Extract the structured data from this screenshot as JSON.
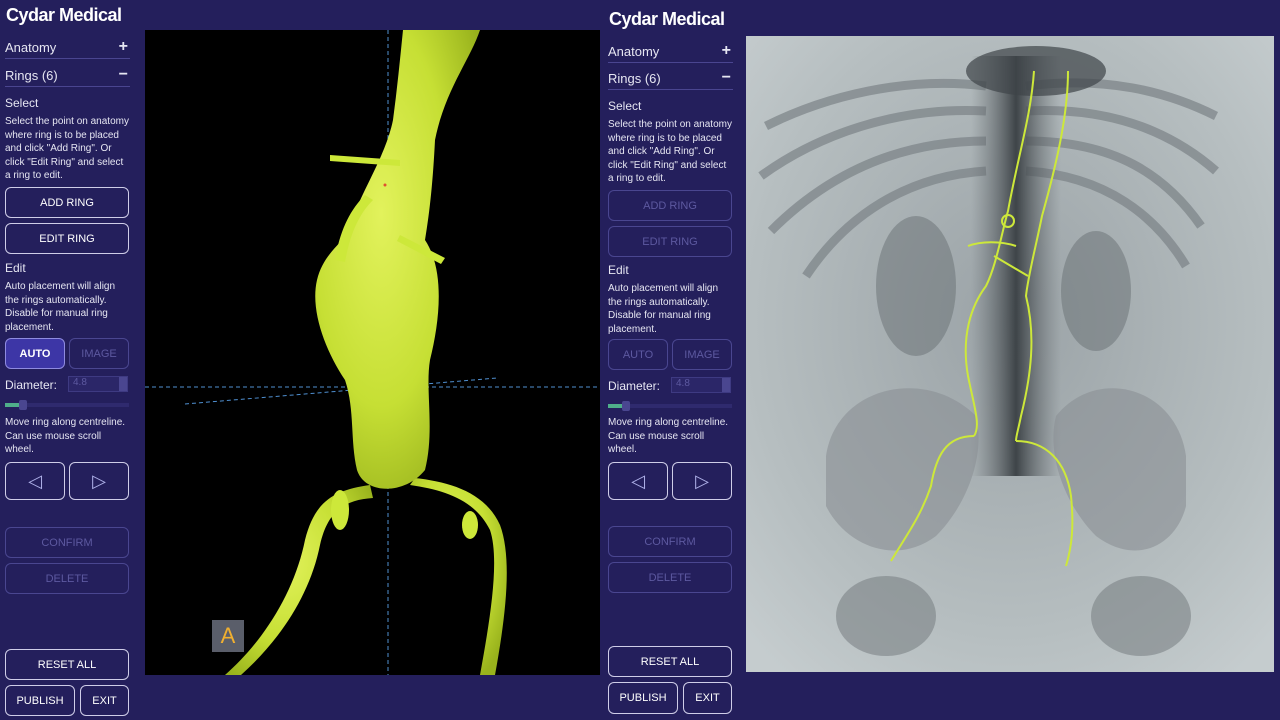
{
  "brand": "Cydar Medical",
  "left_panel": {
    "anatomy_label": "Anatomy",
    "anatomy_toggle": "+",
    "rings_label": "Rings (6)",
    "rings_toggle": "−",
    "select_title": "Select",
    "select_help": "Select the point on anatomy where ring is to be placed and click \"Add Ring\". Or click \"Edit Ring\" and select a ring to edit.",
    "add_ring": "ADD RING",
    "edit_ring": "EDIT RING",
    "edit_title": "Edit",
    "edit_help": "Auto placement will align the rings automatically. Disable for manual ring placement.",
    "auto": "AUTO",
    "image": "IMAGE",
    "diameter_label": "Diameter:",
    "diameter_value": "4.8",
    "slider_level": 0.12,
    "move_help": "Move ring along centreline. Can use mouse scroll wheel.",
    "prev_glyph": "◁",
    "next_glyph": "▷",
    "confirm": "CONFIRM",
    "delete": "DELETE",
    "reset_all": "RESET ALL",
    "publish": "PUBLISH",
    "exit": "EXIT"
  },
  "right_panel": {
    "anatomy_label": "Anatomy",
    "anatomy_toggle": "+",
    "rings_label": "Rings (6)",
    "rings_toggle": "−",
    "select_title": "Select",
    "select_help": "Select the point on anatomy where ring is to be placed and click \"Add Ring\". Or click \"Edit Ring\" and select a ring to edit.",
    "add_ring": "ADD RING",
    "edit_ring": "EDIT RING",
    "edit_title": "Edit",
    "edit_help": "Auto placement will align the rings automatically. Disable for manual ring placement.",
    "auto": "AUTO",
    "image": "IMAGE",
    "diameter_label": "Diameter:",
    "diameter_value": "4.8",
    "slider_level": 0.12,
    "move_help": "Move ring along centreline. Can use mouse scroll wheel.",
    "prev_glyph": "◁",
    "next_glyph": "▷",
    "confirm": "CONFIRM",
    "delete": "DELETE",
    "reset_all": "RESET ALL",
    "publish": "PUBLISH",
    "exit": "EXIT"
  },
  "viewer_3d": {
    "overlay_label": "A"
  },
  "colors": {
    "background": "#241f5c",
    "vessel": "#cde83a",
    "crosshair": "#4f8fd0"
  }
}
